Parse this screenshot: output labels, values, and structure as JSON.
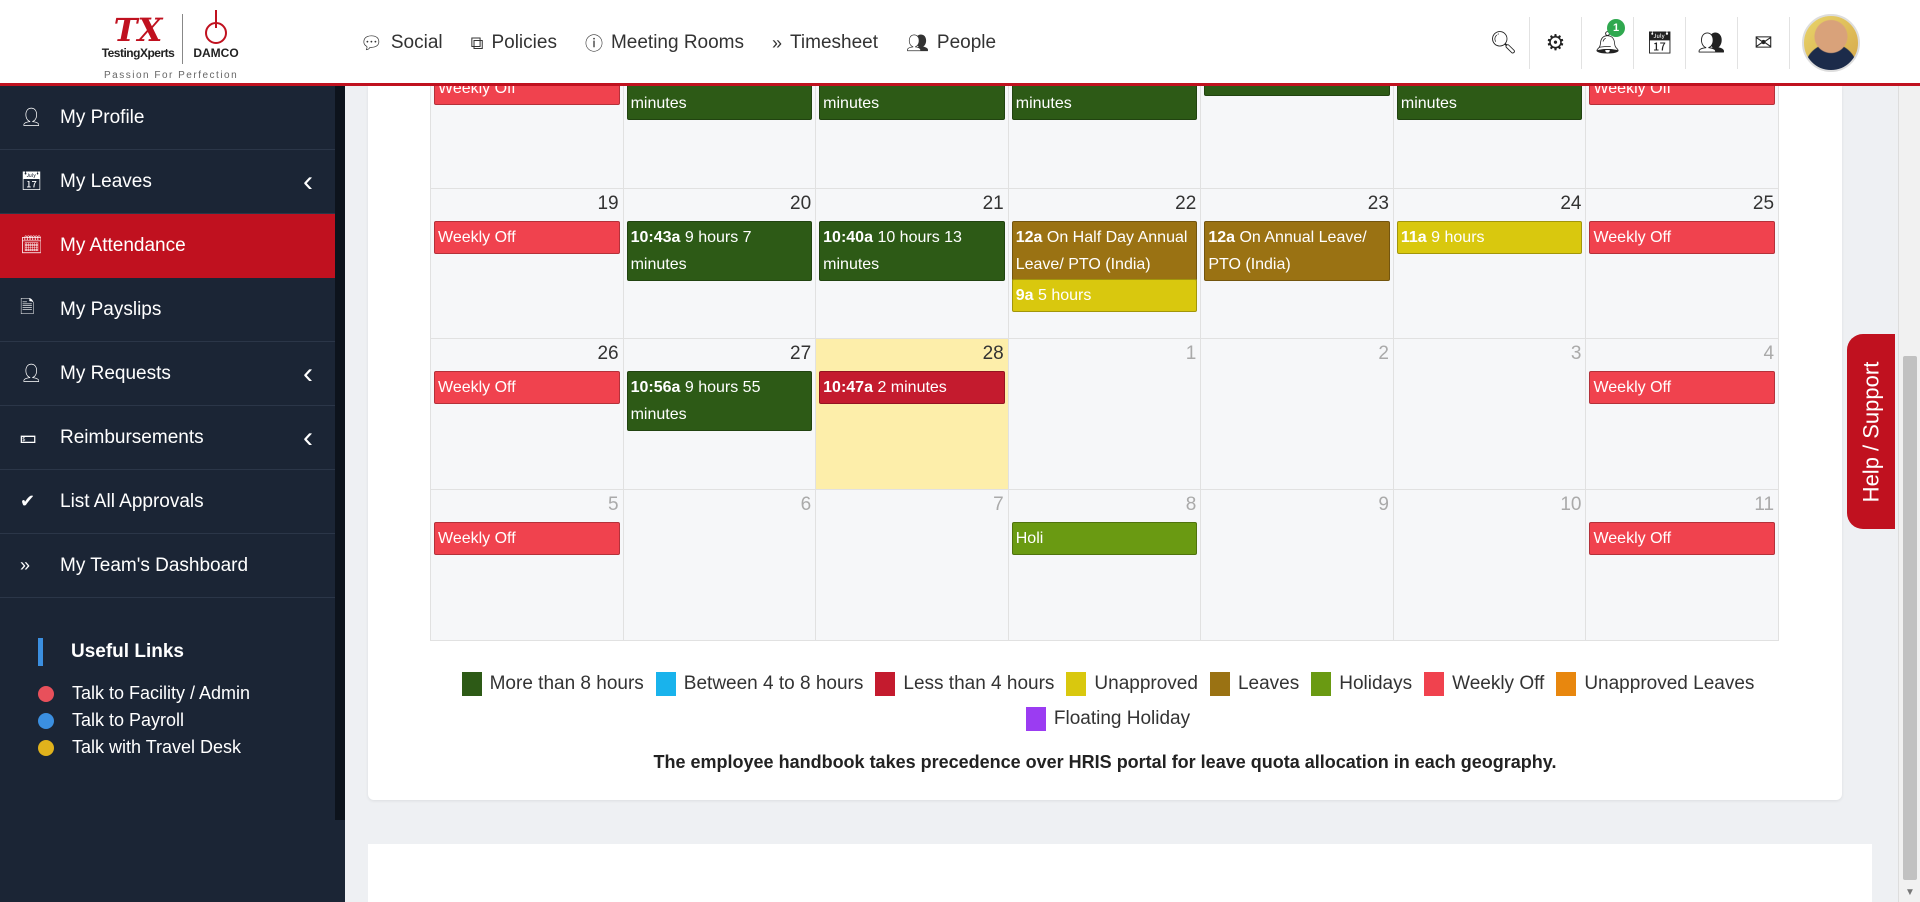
{
  "brand": {
    "logo_mark": "TX",
    "company": "TestingXperts",
    "partner": "DAMCO",
    "tagline": "Passion For Perfection"
  },
  "nav": {
    "items": [
      {
        "label": "Social",
        "icon": "chat-icon"
      },
      {
        "label": "Policies",
        "icon": "copy-icon"
      },
      {
        "label": "Meeting Rooms",
        "icon": "info-icon"
      },
      {
        "label": "Timesheet",
        "icon": "double-chevron-icon"
      },
      {
        "label": "People",
        "icon": "users-icon"
      }
    ]
  },
  "toolbar": {
    "notification_count": "1",
    "icons": [
      "search-icon",
      "gears-icon",
      "bell-icon",
      "calendar-icon",
      "users-icon",
      "envelope-icon"
    ]
  },
  "sidebar": {
    "items": [
      {
        "label": "My Profile",
        "icon": "user-icon",
        "expandable": false,
        "active": false
      },
      {
        "label": "My Leaves",
        "icon": "calendar-icon",
        "expandable": true,
        "active": false
      },
      {
        "label": "My Attendance",
        "icon": "calendar-plus-icon",
        "expandable": false,
        "active": true
      },
      {
        "label": "My Payslips",
        "icon": "file-icon",
        "expandable": false,
        "active": false
      },
      {
        "label": "My Requests",
        "icon": "user-icon",
        "expandable": true,
        "active": false
      },
      {
        "label": "Reimbursements",
        "icon": "money-icon",
        "expandable": true,
        "active": false
      },
      {
        "label": "List All Approvals",
        "icon": "check-icon",
        "expandable": false,
        "active": false
      },
      {
        "label": "My Team's Dashboard",
        "icon": "double-chevron-icon",
        "expandable": false,
        "active": false
      }
    ],
    "useful_links": {
      "title": "Useful Links",
      "links": [
        {
          "label": "Talk to Facility / Admin",
          "color": "#e8505b"
        },
        {
          "label": "Talk to Payroll",
          "color": "#3b8fe0"
        },
        {
          "label": "Talk with Travel Desk",
          "color": "#e0b21c"
        }
      ]
    }
  },
  "colors": {
    "more_than_8": "#2d5a16",
    "between_4_8": "#19b3ec",
    "less_than_4": "#c41b2e",
    "unapproved": "#d9c80e",
    "leaves": "#9a7213",
    "holidays": "#6a9a12",
    "weekly_off": "#f0424e",
    "unapproved_leaves": "#e8870e",
    "floating": "#9b3cf2"
  },
  "calendar": {
    "weeks": [
      {
        "days": [
          {
            "num": "",
            "other": false,
            "today": false,
            "events": [
              {
                "time": "",
                "text": "Weekly Off",
                "color": "weekly_off",
                "cut": true
              }
            ]
          },
          {
            "num": "",
            "other": false,
            "today": false,
            "events": [
              {
                "time": "",
                "text": "minutes",
                "color": "more_than_8",
                "cut": true
              }
            ]
          },
          {
            "num": "",
            "other": false,
            "today": false,
            "events": [
              {
                "time": "",
                "text": "minutes",
                "color": "more_than_8",
                "cut": true
              }
            ]
          },
          {
            "num": "",
            "other": false,
            "today": false,
            "events": [
              {
                "time": "",
                "text": "minutes",
                "color": "more_than_8",
                "cut": true
              }
            ]
          },
          {
            "num": "",
            "other": false,
            "today": false,
            "events": [
              {
                "time": "",
                "text": "",
                "color": "more_than_8",
                "cut": true
              }
            ]
          },
          {
            "num": "",
            "other": false,
            "today": false,
            "events": [
              {
                "time": "",
                "text": "minutes",
                "color": "more_than_8",
                "cut": true
              }
            ]
          },
          {
            "num": "",
            "other": false,
            "today": false,
            "events": [
              {
                "time": "",
                "text": "Weekly Off",
                "color": "weekly_off",
                "cut": true
              }
            ]
          }
        ]
      },
      {
        "days": [
          {
            "num": "19",
            "other": false,
            "today": false,
            "events": [
              {
                "time": "",
                "text": "Weekly Off",
                "color": "weekly_off"
              }
            ]
          },
          {
            "num": "20",
            "other": false,
            "today": false,
            "events": [
              {
                "time": "10:43a",
                "text": "9 hours 7 minutes",
                "color": "more_than_8"
              }
            ]
          },
          {
            "num": "21",
            "other": false,
            "today": false,
            "events": [
              {
                "time": "10:40a",
                "text": "10 hours 13 minutes",
                "color": "more_than_8"
              }
            ]
          },
          {
            "num": "22",
            "other": false,
            "today": false,
            "events": [
              {
                "time": "12a",
                "text": "On Half Day Annual Leave/ PTO (India)",
                "color": "leaves"
              },
              {
                "time": "9a",
                "text": "5 hours",
                "color": "unapproved"
              }
            ]
          },
          {
            "num": "23",
            "other": false,
            "today": false,
            "events": [
              {
                "time": "12a",
                "text": "On Annual Leave/ PTO (India)",
                "color": "leaves"
              }
            ]
          },
          {
            "num": "24",
            "other": false,
            "today": false,
            "events": [
              {
                "time": "11a",
                "text": "9 hours",
                "color": "unapproved"
              }
            ]
          },
          {
            "num": "25",
            "other": false,
            "today": false,
            "events": [
              {
                "time": "",
                "text": "Weekly Off",
                "color": "weekly_off"
              }
            ]
          }
        ]
      },
      {
        "days": [
          {
            "num": "26",
            "other": false,
            "today": false,
            "events": [
              {
                "time": "",
                "text": "Weekly Off",
                "color": "weekly_off"
              }
            ]
          },
          {
            "num": "27",
            "other": false,
            "today": false,
            "events": [
              {
                "time": "10:56a",
                "text": "9 hours 55 minutes",
                "color": "more_than_8"
              }
            ]
          },
          {
            "num": "28",
            "other": false,
            "today": true,
            "events": [
              {
                "time": "10:47a",
                "text": "2 minutes",
                "color": "less_than_4"
              }
            ]
          },
          {
            "num": "1",
            "other": true,
            "today": false,
            "events": []
          },
          {
            "num": "2",
            "other": true,
            "today": false,
            "events": []
          },
          {
            "num": "3",
            "other": true,
            "today": false,
            "events": []
          },
          {
            "num": "4",
            "other": true,
            "today": false,
            "events": [
              {
                "time": "",
                "text": "Weekly Off",
                "color": "weekly_off"
              }
            ]
          }
        ]
      },
      {
        "days": [
          {
            "num": "5",
            "other": true,
            "today": false,
            "events": [
              {
                "time": "",
                "text": "Weekly Off",
                "color": "weekly_off"
              }
            ]
          },
          {
            "num": "6",
            "other": true,
            "today": false,
            "events": []
          },
          {
            "num": "7",
            "other": true,
            "today": false,
            "events": []
          },
          {
            "num": "8",
            "other": true,
            "today": false,
            "events": [
              {
                "time": "",
                "text": "Holi",
                "color": "holidays"
              }
            ]
          },
          {
            "num": "9",
            "other": true,
            "today": false,
            "events": []
          },
          {
            "num": "10",
            "other": true,
            "today": false,
            "events": []
          },
          {
            "num": "11",
            "other": true,
            "today": false,
            "events": [
              {
                "time": "",
                "text": "Weekly Off",
                "color": "weekly_off"
              }
            ]
          }
        ]
      }
    ]
  },
  "legend": [
    {
      "label": "More than 8 hours",
      "color": "more_than_8"
    },
    {
      "label": "Between 4 to 8 hours",
      "color": "between_4_8"
    },
    {
      "label": "Less than 4 hours",
      "color": "less_than_4"
    },
    {
      "label": "Unapproved",
      "color": "unapproved"
    },
    {
      "label": "Leaves",
      "color": "leaves"
    },
    {
      "label": "Holidays",
      "color": "holidays"
    },
    {
      "label": "Weekly Off",
      "color": "weekly_off"
    },
    {
      "label": "Unapproved Leaves",
      "color": "unapproved_leaves"
    },
    {
      "label": "Floating Holiday",
      "color": "floating"
    }
  ],
  "note": "The employee handbook takes precedence over HRIS portal for leave quota allocation in each geography.",
  "help": {
    "label": "Help / Support"
  }
}
